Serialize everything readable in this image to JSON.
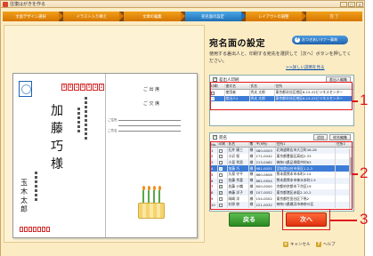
{
  "window": {
    "title": "往復はがきを作る",
    "controls": [
      "-",
      "□",
      "×"
    ]
  },
  "steps": [
    {
      "label": "文面デザイン選択",
      "active": false
    },
    {
      "label": "イラスト入り挿え",
      "active": false
    },
    {
      "label": "文章の編集",
      "active": false
    },
    {
      "label": "宛名面の設定",
      "active": true
    },
    {
      "label": "レイアウトの調整",
      "active": false
    },
    {
      "label": "完 了",
      "active": false
    }
  ],
  "preview": {
    "zip": [
      "9",
      "8",
      "1",
      "0",
      "5",
      "1",
      "2"
    ],
    "recipient_name": [
      "加",
      "藤",
      "巧",
      "様"
    ],
    "sender_name": [
      "玉",
      "木",
      "太",
      "郎"
    ],
    "reply_header": "ご 出 席",
    "reply_sub": "ご 欠 席",
    "line_labels": [
      "ご住所",
      "ご芳名"
    ]
  },
  "panel": {
    "title": "宛名面の設定",
    "manual_button": "おつきあいマナー事典",
    "instruction": "使用する差出人と、印刷する宛先を選択して［次へ］ボタンを押してください。",
    "help_link": ">>詳しい説明を見る",
    "sender_section": {
      "toggle_label": "差出人印刷",
      "edit_label": "差出人編集",
      "columns": [
        "印刷",
        "書式名",
        "氏名",
        "住所"
      ],
      "rows": [
        {
          "checked": false,
          "format": "使用者",
          "name": "秀夫 太郎",
          "address": "東京都渋谷区港区6-15-22ビジネスセンター",
          "selected": false
        },
        {
          "checked": true,
          "format": "差出人1",
          "name": "秀夫 太郎",
          "address": "東京都渋谷区港区6-15-22ビジネスセンター",
          "selected": true
        }
      ]
    },
    "address_section": {
      "toggle_label": "宛名",
      "edit_label": "宛名編集",
      "add_label": "追加",
      "columns": [
        "No.",
        "印刷",
        "氏名",
        "敬",
        "〒(9桁)",
        "住所1",
        "住所2"
      ],
      "rows": [
        {
          "no": "1",
          "checked": false,
          "name": "石井 康三",
          "hon": "様",
          "zip": "080-0003",
          "addr1": "北海道帯広市大正町46-28",
          "addr2": "",
          "state": "alt"
        },
        {
          "no": "2",
          "checked": false,
          "name": "小沢 保",
          "hon": "様",
          "zip": "171-0042",
          "addr1": "東京都豊島区高松2-33",
          "addr2": "",
          "state": ""
        },
        {
          "no": "3",
          "checked": false,
          "name": "小見 秀男",
          "hon": "様",
          "zip": "213-0462",
          "addr1": "神奈川県足柄県中村63",
          "addr2": "",
          "state": "alt"
        },
        {
          "no": "4",
          "checked": true,
          "name": "加藤 巧",
          "hon": "様",
          "zip": "981-0051",
          "addr1": "宮城県仙台市泉区1-2-3",
          "addr2": "",
          "state": "sel"
        },
        {
          "no": "5",
          "checked": false,
          "name": "久保 守平",
          "hon": "様",
          "zip": "860-0808",
          "addr1": "熊本県熊本市本町2-14",
          "addr2": "",
          "state": ""
        },
        {
          "no": "6",
          "checked": false,
          "name": "佐藤 秀喜",
          "hon": "様",
          "zip": "862-0954",
          "addr1": "熊本県熊本市神水本町2-5",
          "addr2": "",
          "state": "alt"
        },
        {
          "no": "7",
          "checked": true,
          "name": "佐藤 沙織",
          "hon": "様",
          "zip": "600-0000",
          "addr1": "京都府京都市下京区19",
          "addr2": "",
          "state": ""
        },
        {
          "no": "8",
          "checked": true,
          "name": "斉藤 洋子",
          "hon": "様",
          "zip": "107-0052",
          "addr1": "東京都港区赤坂2-10-2",
          "addr2": "",
          "state": "alt"
        },
        {
          "no": "9",
          "checked": false,
          "name": "岡崎 洋",
          "hon": "様",
          "zip": "154-0002",
          "addr1": "東京都世田谷区下馬2",
          "addr2": "",
          "state": ""
        },
        {
          "no": "10",
          "checked": false,
          "name": "杉原 修",
          "hon": "様",
          "zip": "221-0032",
          "addr1": "神奈川県横浜市神奈川区",
          "addr2": "",
          "state": "alt"
        }
      ]
    }
  },
  "buttons": {
    "back": "戻る",
    "next": "次へ"
  },
  "footer": {
    "cancel": "キャンセル",
    "help": "ヘルプ"
  },
  "callouts": [
    "1",
    "2",
    "3"
  ],
  "colors": {
    "accent_red": "#e0151c",
    "step_active": "#1f6fb5",
    "step_inactive": "#d67500",
    "back_green": "#2a8a22",
    "next_orange": "#e0320f"
  }
}
